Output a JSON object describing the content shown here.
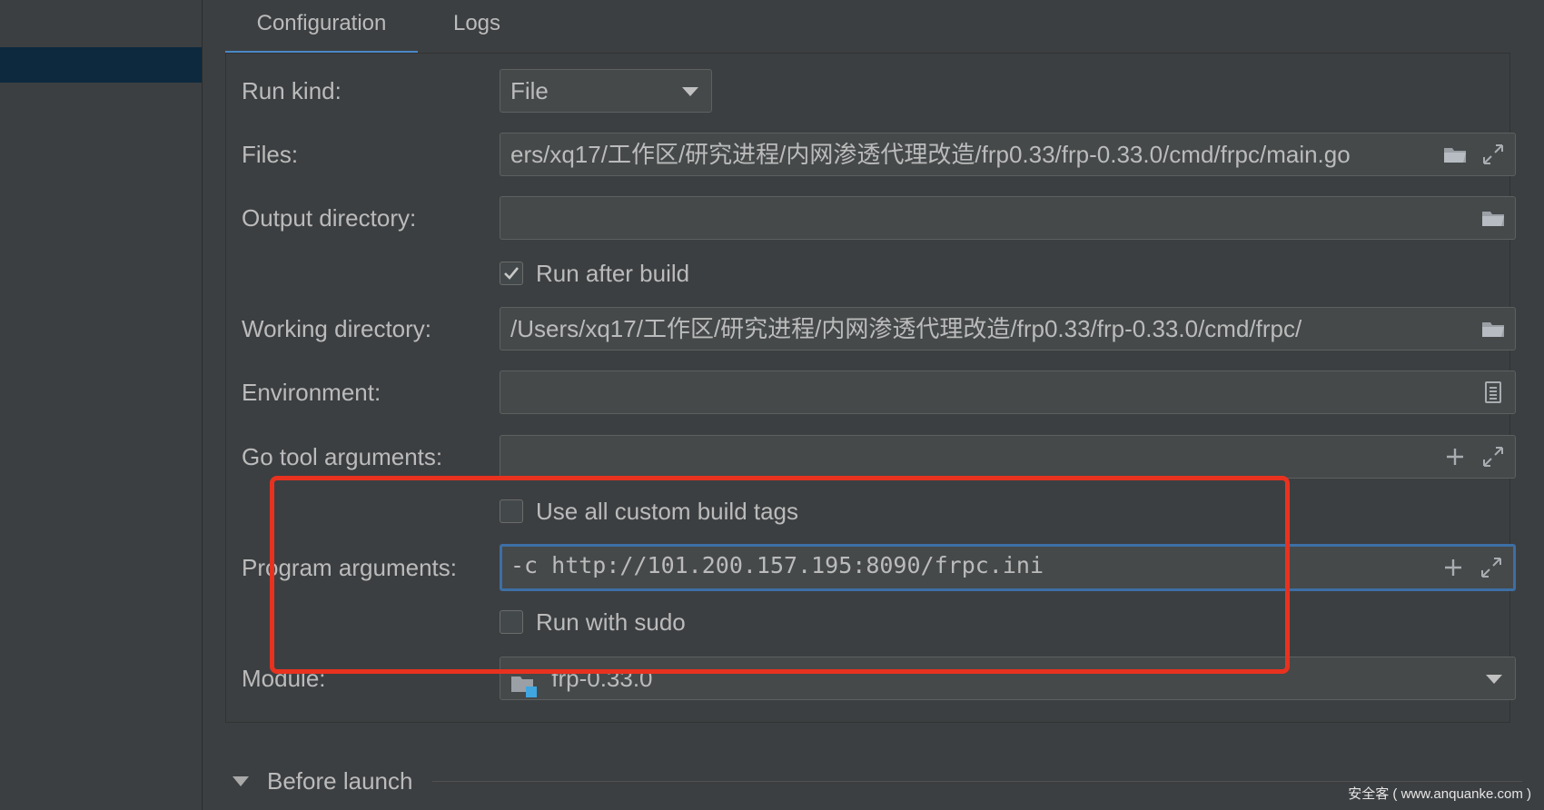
{
  "tabs": [
    {
      "label": "Configuration",
      "active": true
    },
    {
      "label": "Logs",
      "active": false
    }
  ],
  "form": {
    "run_kind": {
      "label": "Run kind:",
      "value": "File"
    },
    "files": {
      "label": "Files:",
      "value": "ers/xq17/工作区/研究进程/内网渗透代理改造/frp0.33/frp-0.33.0/cmd/frpc/main.go"
    },
    "output_directory": {
      "label": "Output directory:",
      "value": ""
    },
    "run_after_build": {
      "label": "Run after build",
      "checked": true
    },
    "working_directory": {
      "label": "Working directory:",
      "value": "/Users/xq17/工作区/研究进程/内网渗透代理改造/frp0.33/frp-0.33.0/cmd/frpc/"
    },
    "environment": {
      "label": "Environment:",
      "value": ""
    },
    "go_tool_arguments": {
      "label": "Go tool arguments:",
      "value": ""
    },
    "use_custom_build_tags": {
      "label": "Use all custom build tags",
      "checked": false
    },
    "program_arguments": {
      "label": "Program arguments:",
      "value": "-c http://101.200.157.195:8090/frpc.ini"
    },
    "run_with_sudo": {
      "label": "Run with sudo",
      "checked": false
    },
    "module": {
      "label": "Module:",
      "value": "frp-0.33.0"
    }
  },
  "before_launch": {
    "label": "Before launch"
  },
  "watermark": "安全客 ( www.anquanke.com )",
  "colors": {
    "background": "#3c3f41",
    "field_bg": "#45494a",
    "selected": "#0d293e",
    "accent": "#4a88c7",
    "highlight_box": "#e8321f"
  },
  "icons": [
    "folder-icon",
    "expand-icon",
    "clipboard-icon",
    "plus-icon",
    "module-icon",
    "chevron-down-icon",
    "check-icon"
  ]
}
